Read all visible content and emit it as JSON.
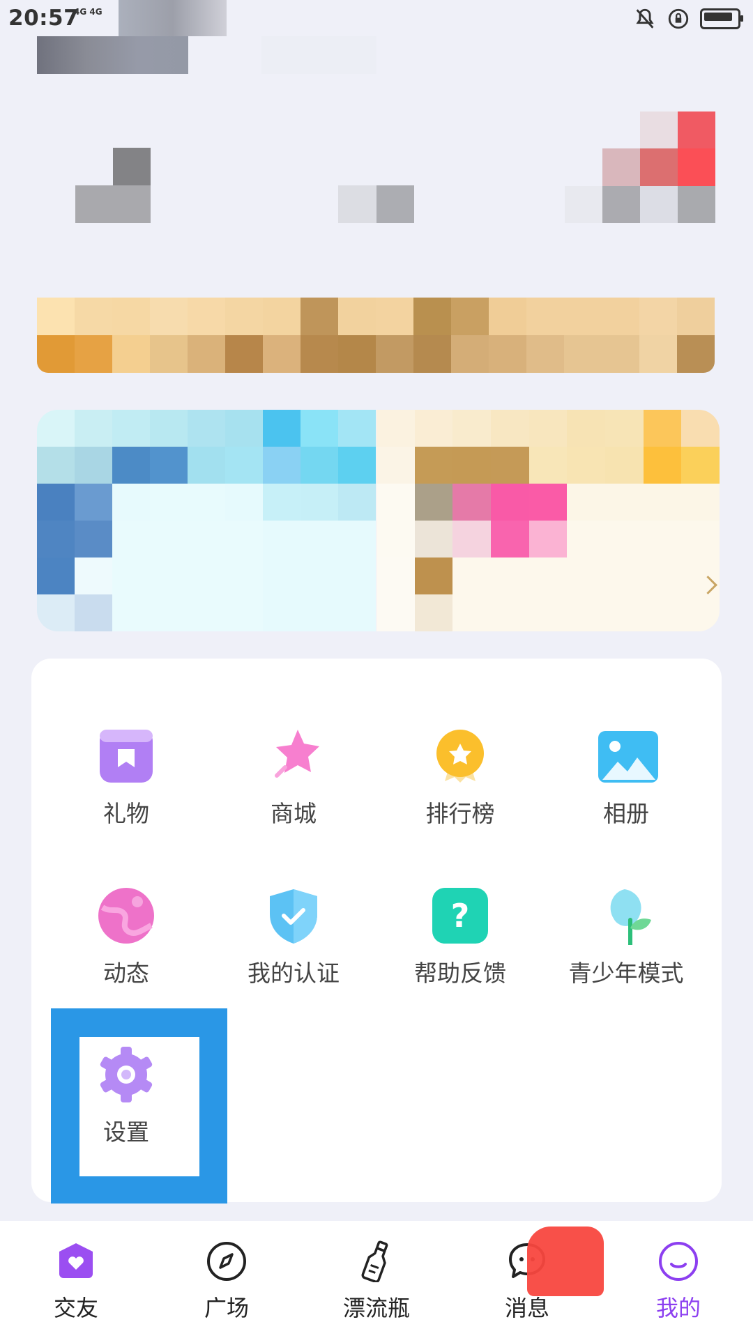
{
  "status_bar": {
    "time": "20:57",
    "network": "4G 4G"
  },
  "menu": {
    "items": [
      {
        "label": "礼物",
        "icon": "gift-icon"
      },
      {
        "label": "商城",
        "icon": "star-wand-icon"
      },
      {
        "label": "排行榜",
        "icon": "medal-icon"
      },
      {
        "label": "相册",
        "icon": "photo-album-icon"
      },
      {
        "label": "动态",
        "icon": "planet-icon"
      },
      {
        "label": "我的认证",
        "icon": "shield-check-icon"
      },
      {
        "label": "帮助反馈",
        "icon": "help-question-icon"
      },
      {
        "label": "青少年模式",
        "icon": "sprout-leaf-icon"
      },
      {
        "label": "设置",
        "icon": "gear-icon"
      }
    ]
  },
  "bottom_nav": {
    "items": [
      {
        "label": "交友",
        "icon": "home-heart-icon"
      },
      {
        "label": "广场",
        "icon": "compass-icon"
      },
      {
        "label": "漂流瓶",
        "icon": "bottle-icon"
      },
      {
        "label": "消息",
        "icon": "chat-bubble-icon"
      },
      {
        "label": "我的",
        "icon": "profile-smile-icon",
        "active": true
      }
    ]
  },
  "colors": {
    "accent": "#8c3ff0",
    "highlight": "#2a97e6",
    "background": "#eff0f8"
  }
}
